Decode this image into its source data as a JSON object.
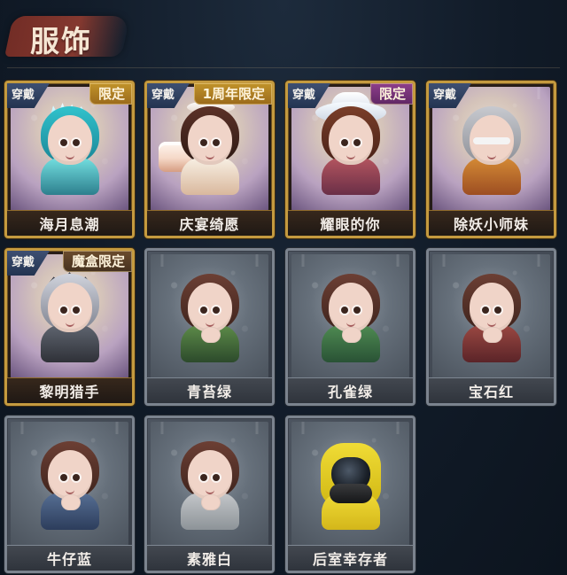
{
  "section": {
    "title": "服饰"
  },
  "cards": [
    {
      "name": "海月息潮",
      "wear_label": "穿戴",
      "badge": "限定",
      "badge_style": "gold",
      "card_style": "gold",
      "portrait_icon": "sea-moon-tide-character-icon"
    },
    {
      "name": "庆宴绮愿",
      "wear_label": "穿戴",
      "badge": "1周年限定",
      "badge_style": "gold",
      "card_style": "gold",
      "portrait_icon": "anniversary-cake-character-icon"
    },
    {
      "name": "耀眼的你",
      "wear_label": "穿戴",
      "badge": "限定",
      "badge_style": "purple",
      "card_style": "gold",
      "portrait_icon": "dazzling-you-cowboy-hat-character-icon"
    },
    {
      "name": "除妖小师妹",
      "wear_label": "穿戴",
      "badge": "",
      "badge_style": "",
      "card_style": "gold",
      "portrait_icon": "blindfolded-silver-hair-character-icon"
    },
    {
      "name": "黎明猎手",
      "wear_label": "穿戴",
      "badge": "魔盒限定",
      "badge_style": "dark",
      "card_style": "gold",
      "portrait_icon": "dawn-hunter-character-icon"
    },
    {
      "name": "青苔绿",
      "wear_label": "",
      "badge": "",
      "badge_style": "",
      "card_style": "silver",
      "portrait_icon": "moss-green-girl-character-icon"
    },
    {
      "name": "孔雀绿",
      "wear_label": "",
      "badge": "",
      "badge_style": "",
      "card_style": "silver",
      "portrait_icon": "peacock-green-girl-character-icon"
    },
    {
      "name": "宝石红",
      "wear_label": "",
      "badge": "",
      "badge_style": "",
      "card_style": "silver",
      "portrait_icon": "ruby-red-girl-character-icon"
    },
    {
      "name": "牛仔蓝",
      "wear_label": "",
      "badge": "",
      "badge_style": "",
      "card_style": "silver",
      "portrait_icon": "denim-blue-girl-character-icon"
    },
    {
      "name": "素雅白",
      "wear_label": "",
      "badge": "",
      "badge_style": "",
      "card_style": "silver",
      "portrait_icon": "plain-white-girl-character-icon"
    },
    {
      "name": "后室幸存者",
      "wear_label": "",
      "badge": "",
      "badge_style": "",
      "card_style": "silver",
      "portrait_icon": "backrooms-survivor-hazmat-character-icon"
    }
  ],
  "colors": {
    "background": "#101a27",
    "gold_frame": "#c49a3f",
    "silver_frame": "#7b838e",
    "title_text": "#f5e6d3",
    "wear_badge": "#2d3f62",
    "limited_gold": "#b6861f",
    "limited_purple": "#7b3678",
    "limited_dark": "#5b402a"
  }
}
